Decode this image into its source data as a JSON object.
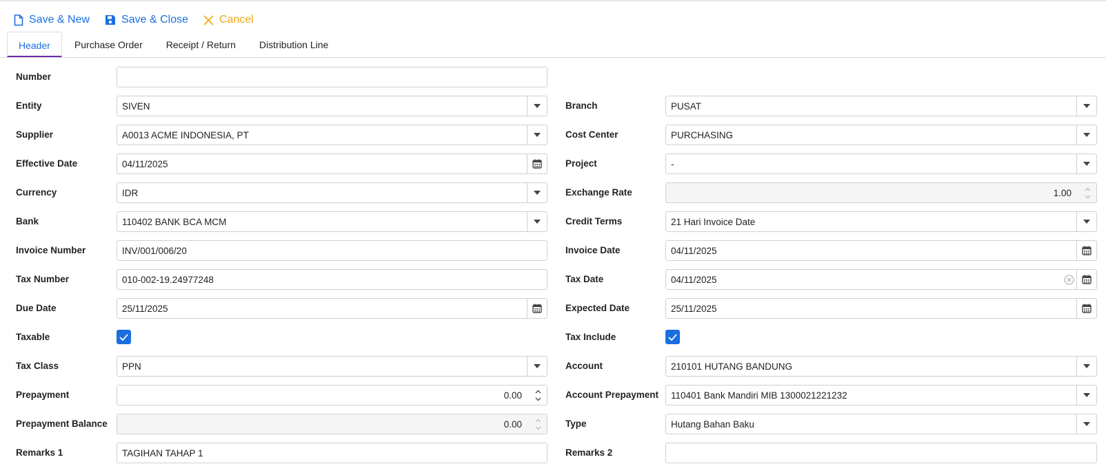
{
  "toolbar": {
    "save_new_label": "Save & New",
    "save_close_label": "Save & Close",
    "cancel_label": "Cancel"
  },
  "tabs": [
    "Header",
    "Purchase Order",
    "Receipt / Return",
    "Distribution Line"
  ],
  "active_tab": "Header",
  "colors": {
    "accent": "#1a6fe0",
    "cancel": "#f0a81a",
    "tab_underline": "#6a2ca8"
  },
  "form": {
    "number": {
      "label": "Number",
      "value": ""
    },
    "entity": {
      "label": "Entity",
      "value": "SIVEN"
    },
    "branch": {
      "label": "Branch",
      "value": "PUSAT"
    },
    "supplier": {
      "label": "Supplier",
      "value": "A0013 ACME INDONESIA, PT"
    },
    "cost_center": {
      "label": "Cost Center",
      "value": "PURCHASING"
    },
    "effective_date": {
      "label": "Effective Date",
      "value": "04/11/2025"
    },
    "project": {
      "label": "Project",
      "value": "-"
    },
    "currency": {
      "label": "Currency",
      "value": "IDR"
    },
    "exchange_rate": {
      "label": "Exchange Rate",
      "value": "1.00"
    },
    "bank": {
      "label": "Bank",
      "value": "110402 BANK BCA MCM"
    },
    "credit_terms": {
      "label": "Credit Terms",
      "value": "21 Hari Invoice Date"
    },
    "invoice_number": {
      "label": "Invoice Number",
      "value": "INV/001/006/20"
    },
    "invoice_date": {
      "label": "Invoice Date",
      "value": "04/11/2025"
    },
    "tax_number": {
      "label": "Tax Number",
      "value": "010-002-19.24977248"
    },
    "tax_date": {
      "label": "Tax Date",
      "value": "04/11/2025"
    },
    "due_date": {
      "label": "Due Date",
      "value": "25/11/2025"
    },
    "expected_date": {
      "label": "Expected Date",
      "value": "25/11/2025"
    },
    "taxable": {
      "label": "Taxable",
      "checked": true
    },
    "tax_include": {
      "label": "Tax Include",
      "checked": true
    },
    "tax_class": {
      "label": "Tax Class",
      "value": "PPN"
    },
    "account": {
      "label": "Account",
      "value": "210101 HUTANG BANDUNG"
    },
    "prepayment": {
      "label": "Prepayment",
      "value": "0.00"
    },
    "account_prepayment": {
      "label": "Account Prepayment",
      "value": "110401 Bank Mandiri MIB 1300021221232"
    },
    "prepayment_balance": {
      "label": "Prepayment Balance",
      "value": "0.00"
    },
    "type": {
      "label": "Type",
      "value": "Hutang Bahan Baku"
    },
    "remarks1": {
      "label": "Remarks 1",
      "value": "TAGIHAN TAHAP 1"
    },
    "remarks2": {
      "label": "Remarks 2",
      "value": ""
    }
  }
}
